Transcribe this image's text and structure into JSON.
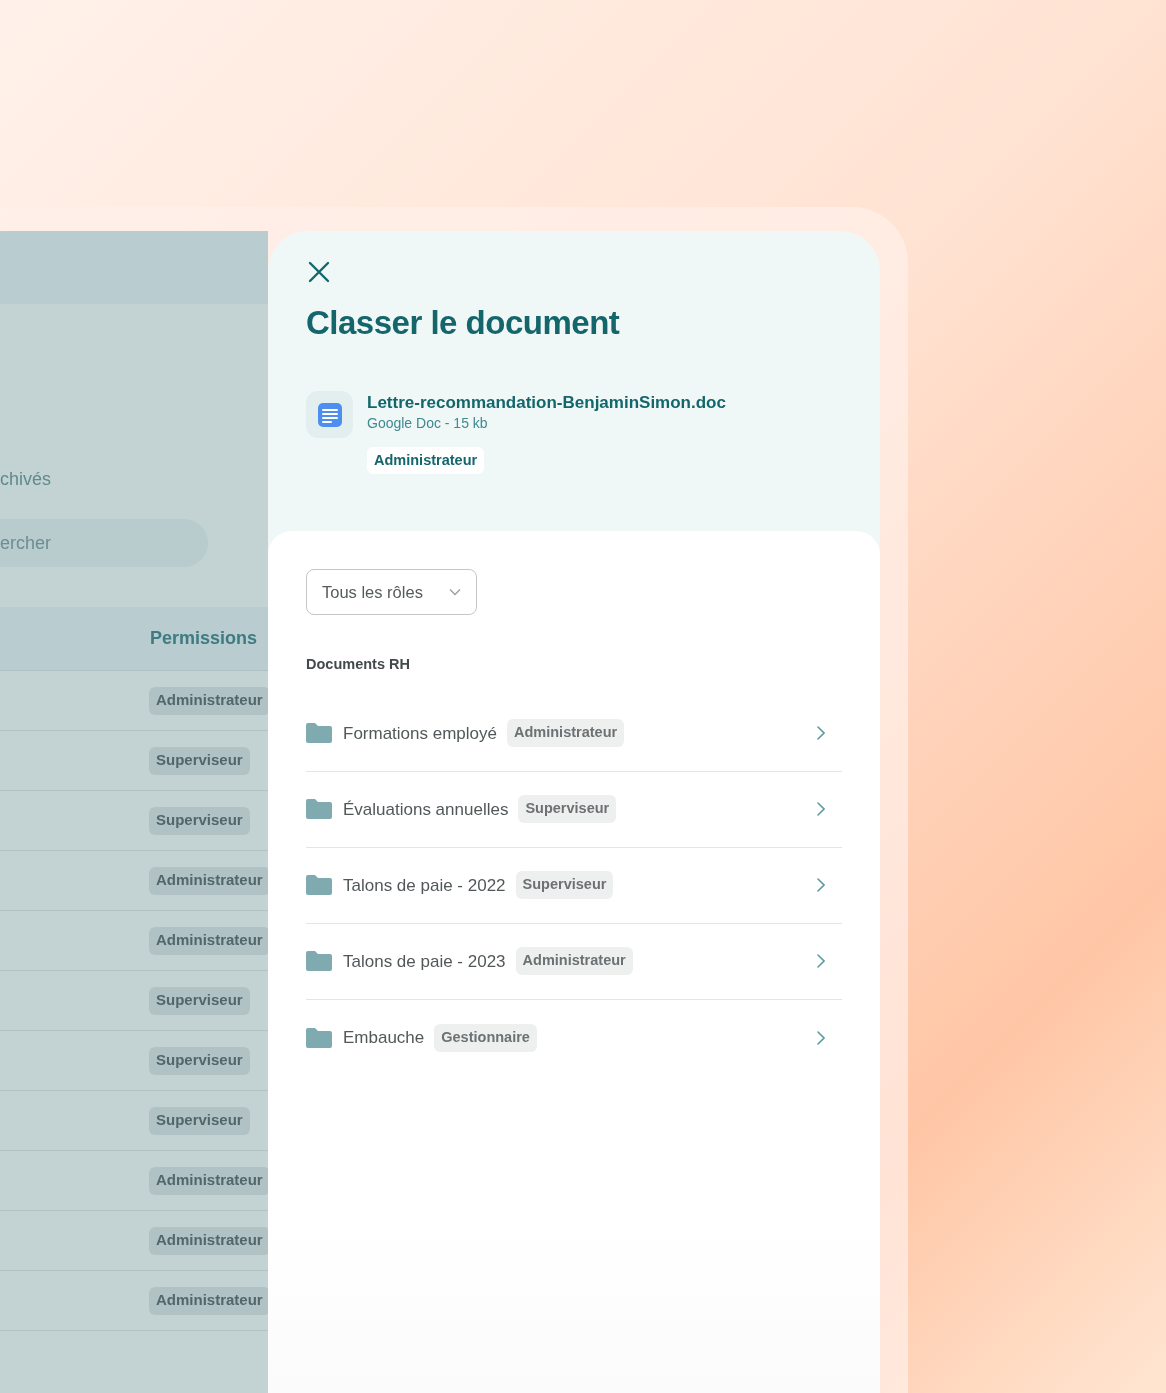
{
  "backdrop": {
    "tab_label": "chivés",
    "search": {
      "placeholder": "ercher"
    },
    "table": {
      "columns": [
        "Permissions"
      ],
      "rows": [
        {
          "permission": "Administrateur"
        },
        {
          "permission": "Superviseur"
        },
        {
          "permission": "Superviseur"
        },
        {
          "permission": "Administrateur"
        },
        {
          "permission": "Administrateur"
        },
        {
          "permission": "Superviseur"
        },
        {
          "permission": "Superviseur"
        },
        {
          "permission": "Superviseur"
        },
        {
          "permission": "Administrateur"
        },
        {
          "permission": "Administrateur"
        },
        {
          "permission": "Administrateur"
        }
      ]
    }
  },
  "dialog": {
    "title": "Classer le document",
    "file": {
      "name": "Lettre-recommandation-BenjaminSimon.doc",
      "meta": "Google Doc - 15 kb",
      "role": "Administrateur"
    },
    "filter": {
      "value": "Tous les rôles"
    },
    "section_title": "Documents RH",
    "folders": [
      {
        "name": "Formations employé",
        "role": "Administrateur"
      },
      {
        "name": "Évaluations annuelles",
        "role": "Superviseur"
      },
      {
        "name": "Talons de paie - 2022",
        "role": "Superviseur"
      },
      {
        "name": "Talons de paie - 2023",
        "role": "Administrateur"
      },
      {
        "name": "Embauche",
        "role": "Gestionnaire"
      }
    ]
  }
}
